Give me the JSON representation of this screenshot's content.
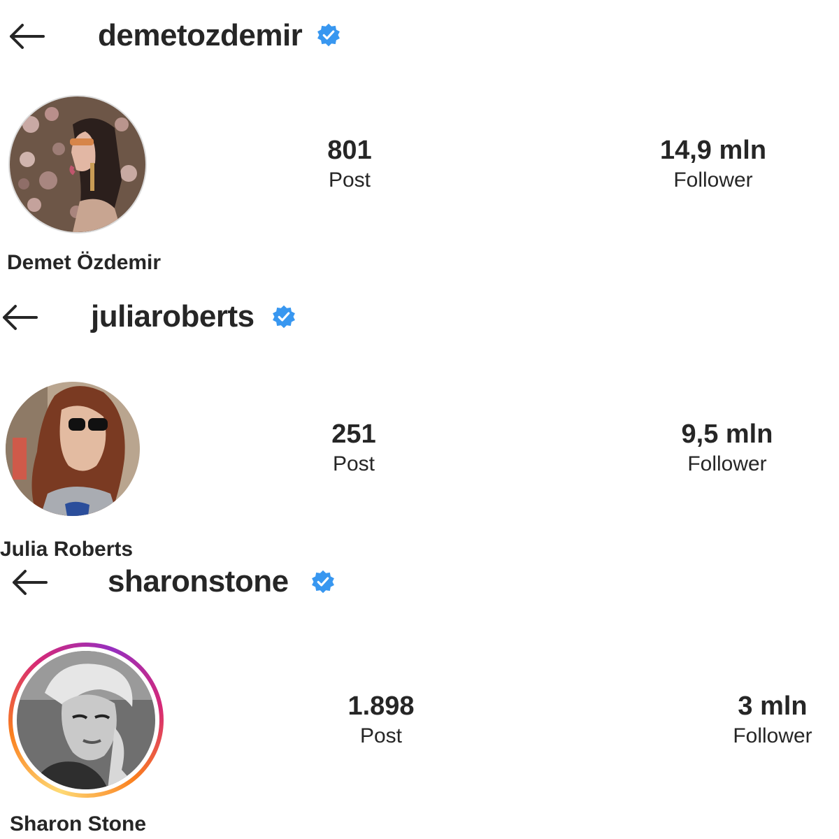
{
  "profiles": [
    {
      "username": "demetozdemir",
      "full_name": "Demet Özdemir",
      "posts_count": "801",
      "posts_label": "Post",
      "followers_count": "14,9 mln",
      "followers_label": "Follower",
      "verified": true,
      "story_ring": false
    },
    {
      "username": "juliaroberts",
      "full_name": "Julia Roberts",
      "posts_count": "251",
      "posts_label": "Post",
      "followers_count": "9,5 mln",
      "followers_label": "Follower",
      "verified": true,
      "story_ring": false
    },
    {
      "username": "sharonstone",
      "full_name": "Sharon Stone",
      "posts_count": "1.898",
      "posts_label": "Post",
      "followers_count": "3 mln",
      "followers_label": "Follower",
      "verified": true,
      "story_ring": true
    }
  ],
  "colors": {
    "verified_badge": "#3897f0",
    "text": "#262626",
    "story_ring_start": "#feda75",
    "story_ring_mid": "#fa7e1e",
    "story_ring_end": "#d62976"
  },
  "icons": {
    "back": "back-arrow-icon",
    "verified": "verified-badge-icon"
  }
}
